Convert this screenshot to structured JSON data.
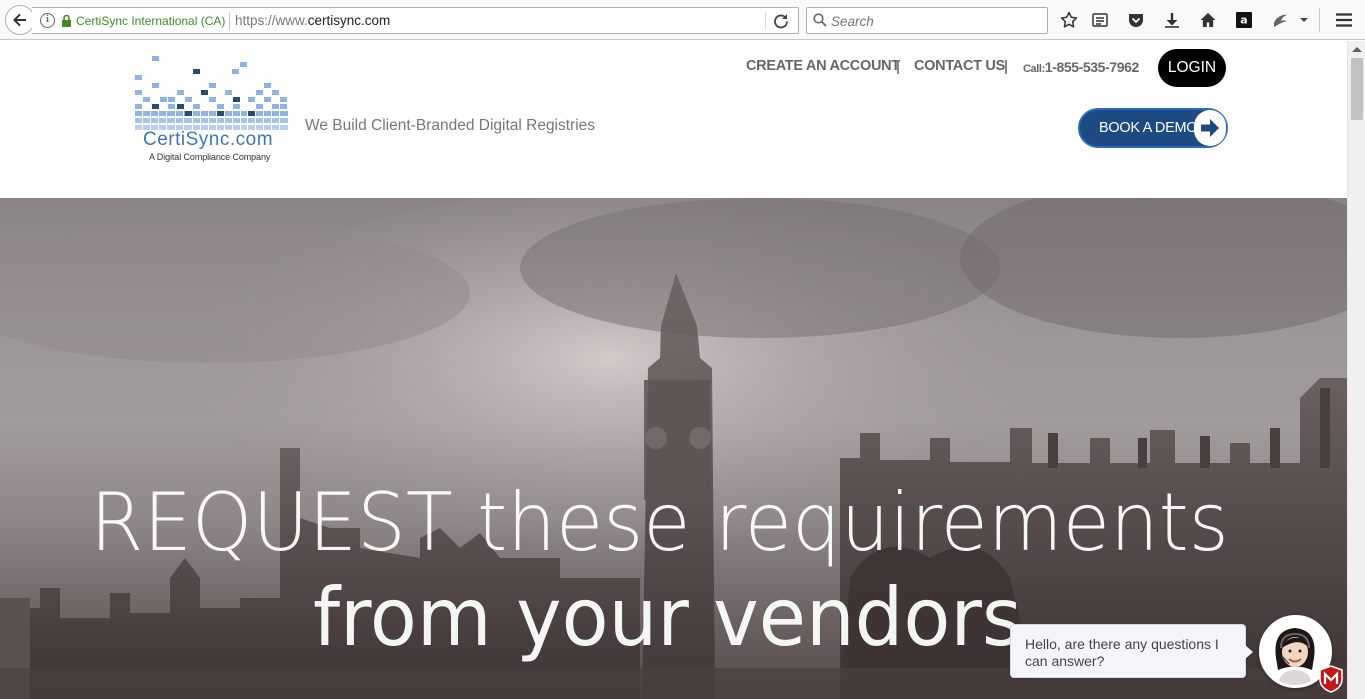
{
  "browser": {
    "site_identity": "CertiSync International (CA)",
    "url_prefix": "https://www.",
    "url_domain": "certisync.com",
    "search_placeholder": "Search",
    "icons": [
      "back-icon",
      "info-icon",
      "lock-icon",
      "reload-icon",
      "search-icon",
      "bookmark-star-icon",
      "reading-list-icon",
      "pocket-icon",
      "download-icon",
      "home-icon",
      "amazon-icon",
      "extension-icon",
      "overflow-chevron-icon",
      "menu-icon"
    ]
  },
  "header": {
    "logo_text": "CertiSync.com",
    "logo_tagline": "A Digital Compliance Company",
    "tagline": "We Build Client-Branded Digital Registries",
    "nav": {
      "create_account": "CREATE AN ACCOUNT",
      "contact_us": "CONTACT US"
    },
    "call_prefix": "Call:",
    "call_number": "1-855-535-7962",
    "login_label": "LOGIN",
    "demo_label": "BOOK A DEMO"
  },
  "hero": {
    "line1": "REQUEST these requirements",
    "line2": "from your vendors"
  },
  "chat": {
    "message": "Hello, are there any questions I can answer?"
  },
  "colors": {
    "brand_blue": "#1d4a83",
    "logo_blue": "#3f76b5",
    "secure_green": "#3c8c23"
  }
}
